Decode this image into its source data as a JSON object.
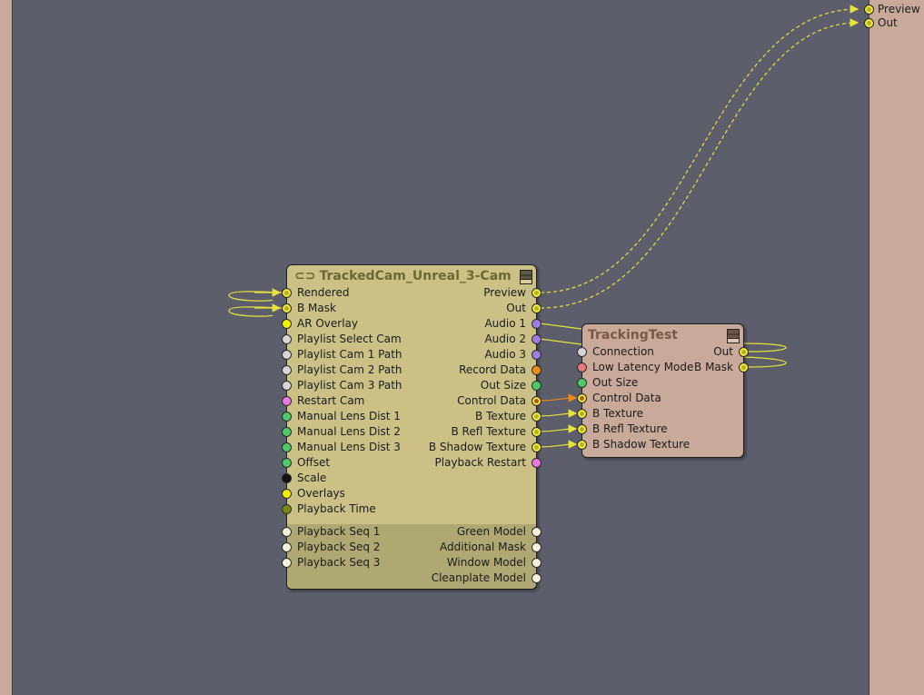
{
  "colors": {
    "canvas": "#5c5e6b",
    "panel": "#c9a999",
    "node_cam": "#cbc187",
    "node_cam_lower": "#b0a872",
    "node_tracking": "#c9a999",
    "wire_yellow": "#e8e33c",
    "wire_orange": "#ea8a1e"
  },
  "external_outputs": [
    {
      "label": "Preview",
      "color": "#b8b21c"
    },
    {
      "label": "Out",
      "color": "#b8b21c"
    }
  ],
  "node_cam": {
    "title": "TrackedCam_Unreal_3-Cam",
    "title_icon": "link-icon",
    "menu_icon": "node-menu-icon",
    "inputs": [
      {
        "label": "Rendered",
        "color": "#b8b21c",
        "linked": true
      },
      {
        "label": "B Mask",
        "color": "#b8b21c",
        "linked": true
      },
      {
        "label": "AR Overlay",
        "color": "#f5f000"
      },
      {
        "label": "Playlist Select Cam",
        "color": "#d6d6d6"
      },
      {
        "label": "Playlist Cam 1 Path",
        "color": "#d6d6d6"
      },
      {
        "label": "Playlist Cam 2 Path",
        "color": "#d6d6d6"
      },
      {
        "label": "Playlist Cam 3 Path",
        "color": "#d6d6d6"
      },
      {
        "label": "Restart Cam",
        "color": "#e879e0"
      },
      {
        "label": "Manual Lens Dist 1",
        "color": "#4ec96a"
      },
      {
        "label": "Manual Lens Dist 2",
        "color": "#4ec96a"
      },
      {
        "label": "Manual Lens Dist 3",
        "color": "#4ec96a"
      },
      {
        "label": "Offset",
        "color": "#4ec96a"
      },
      {
        "label": "Scale",
        "color": "#111111"
      },
      {
        "label": "Overlays",
        "color": "#f5f000"
      },
      {
        "label": "Playback Time",
        "color": "#7d8a12"
      }
    ],
    "outputs": [
      {
        "label": "Preview",
        "color": "#b8b21c",
        "linked": true
      },
      {
        "label": "Out",
        "color": "#b8b21c",
        "linked": true
      },
      {
        "label": "Audio 1",
        "color": "#9b7ee0"
      },
      {
        "label": "Audio 2",
        "color": "#9b7ee0"
      },
      {
        "label": "Audio 3",
        "color": "#9b7ee0"
      },
      {
        "label": "Record Data",
        "color": "#f08a18"
      },
      {
        "label": "Out Size",
        "color": "#4ec96a"
      },
      {
        "label": "Control Data",
        "color": "#b05a10",
        "linked": true
      },
      {
        "label": "B Texture",
        "color": "#b8b21c",
        "linked": true
      },
      {
        "label": "B Refl Texture",
        "color": "#b8b21c",
        "linked": true
      },
      {
        "label": "B Shadow Texture",
        "color": "#b8b21c",
        "linked": true
      },
      {
        "label": "Playback Restart",
        "color": "#e879e0"
      }
    ],
    "lower_inputs": [
      {
        "label": "Playback Seq 1",
        "color": "#f4f2dc"
      },
      {
        "label": "Playback Seq 2",
        "color": "#f4f2dc"
      },
      {
        "label": "Playback Seq 3",
        "color": "#f4f2dc"
      }
    ],
    "lower_outputs": [
      {
        "label": "Green Model",
        "color": "#f4f2dc"
      },
      {
        "label": "Additional Mask",
        "color": "#f4f2dc"
      },
      {
        "label": "Window Model",
        "color": "#f4f2dc"
      },
      {
        "label": "Cleanplate Model",
        "color": "#f4f2dc"
      }
    ]
  },
  "node_tracking": {
    "title": "TrackingTest",
    "menu_icon": "node-menu-icon",
    "inputs": [
      {
        "label": "Connection",
        "color": "#d6d6d6"
      },
      {
        "label": "Low Latency Mode",
        "color": "#e87a7a"
      },
      {
        "label": "Out Size",
        "color": "#4ec96a"
      },
      {
        "label": "Control Data",
        "color": "#b05a10",
        "linked": true
      },
      {
        "label": "B Texture",
        "color": "#b8b21c",
        "linked": true
      },
      {
        "label": "B Refl Texture",
        "color": "#b8b21c",
        "linked": true
      },
      {
        "label": "B Shadow Texture",
        "color": "#b8b21c",
        "linked": true
      }
    ],
    "outputs": [
      {
        "label": "Out",
        "color": "#b8b21c",
        "linked": true
      },
      {
        "label": "B Mask",
        "color": "#b8b21c",
        "linked": true
      }
    ]
  }
}
